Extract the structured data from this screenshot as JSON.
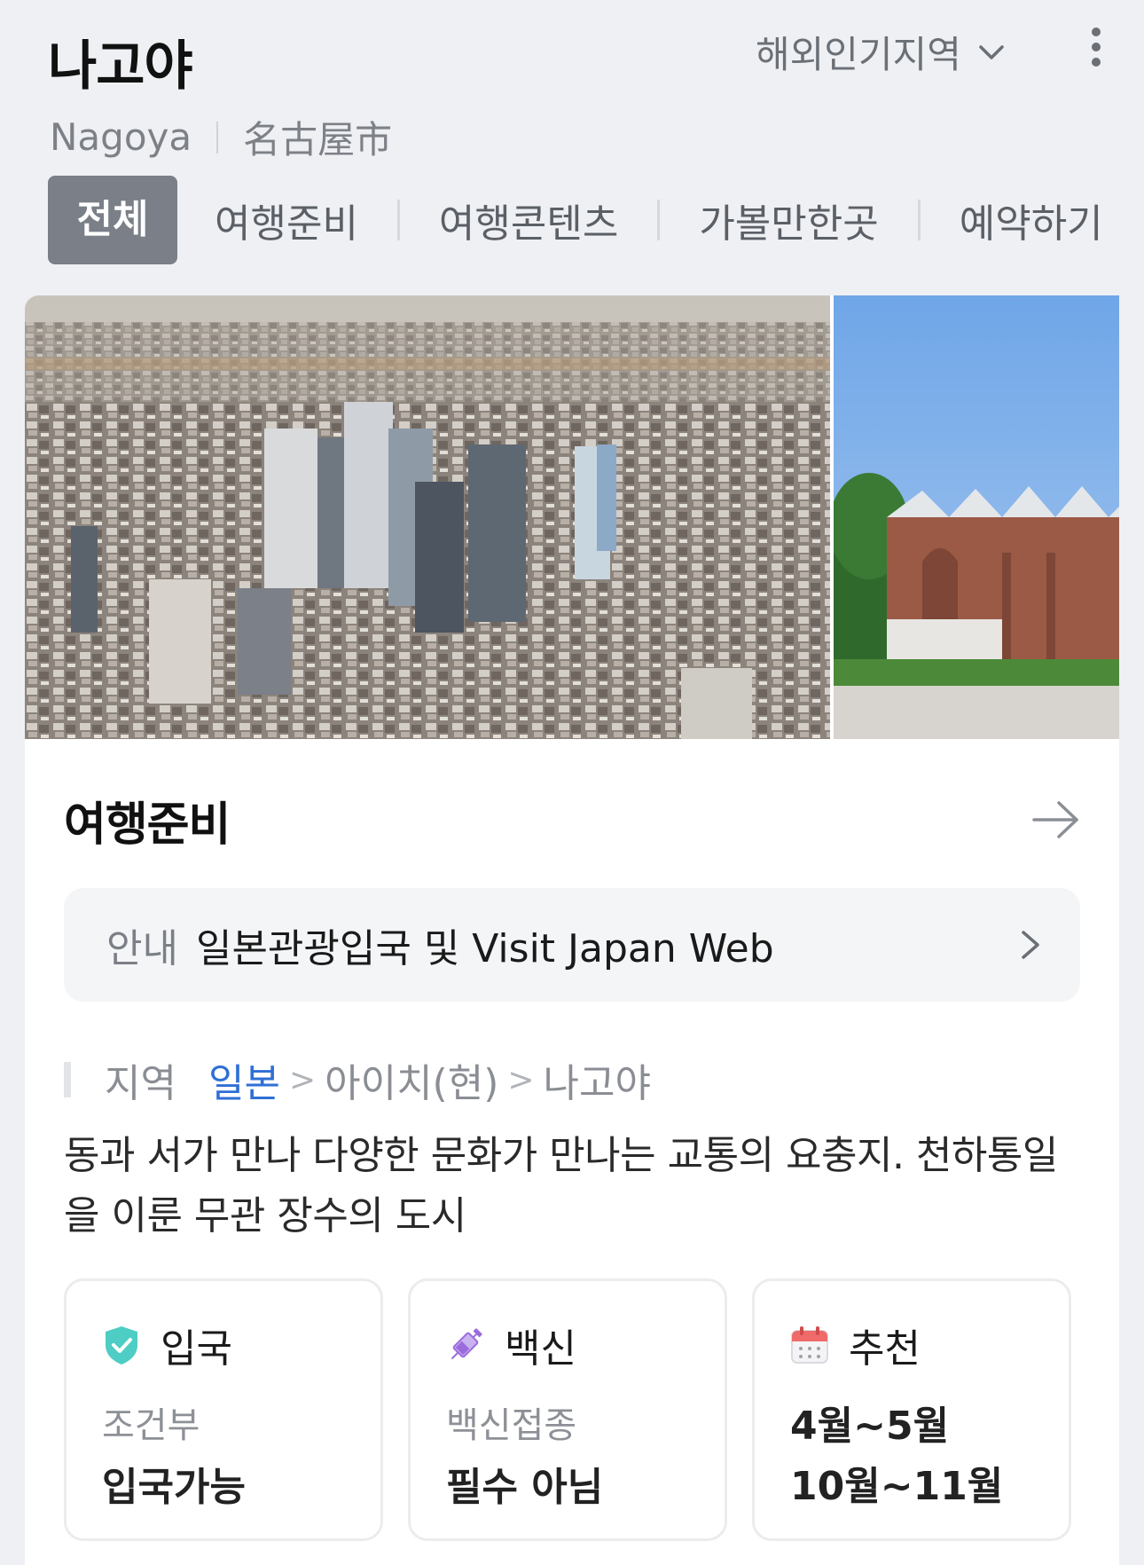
{
  "header": {
    "title": "나고야",
    "region_select": "해외인기지역",
    "subtitle_en": "Nagoya",
    "subtitle_jp": "名古屋市"
  },
  "tabs": [
    {
      "label": "전체",
      "active": true
    },
    {
      "label": "여행준비"
    },
    {
      "label": "여행콘텐츠"
    },
    {
      "label": "가볼만한곳"
    },
    {
      "label": "예약하기"
    }
  ],
  "section": {
    "title": "여행준비",
    "notice_tag": "안내",
    "notice_text": "일본관광입국 및 Visit Japan Web"
  },
  "breadcrumb": {
    "label": "지역",
    "country": "일본",
    "prefecture": "아이치(현)",
    "city": "나고야"
  },
  "description": "동과 서가 만나 다양한 문화가 만나는 교통의 요충지. 천하통일을 이룬 무관 장수의 도시",
  "info": {
    "entry": {
      "title": "입국",
      "sub": "조건부",
      "value": "입국가능"
    },
    "vaccine": {
      "title": "백신",
      "sub": "백신접종",
      "value": "필수 아님"
    },
    "recommend": {
      "title": "추천",
      "line1": "4월~5월",
      "line2": "10월~11월"
    }
  },
  "colors": {
    "accent_link": "#2f6fd6",
    "tab_active_bg": "#7a7f88",
    "shield": "#4ecdc4",
    "syringe": "#9b6bdc",
    "calendar": "#f06a6a"
  },
  "icons": [
    "chevron-down-icon",
    "more-vertical-icon",
    "arrow-right-icon",
    "chevron-right-icon",
    "shield-check-icon",
    "syringe-icon",
    "calendar-icon"
  ]
}
